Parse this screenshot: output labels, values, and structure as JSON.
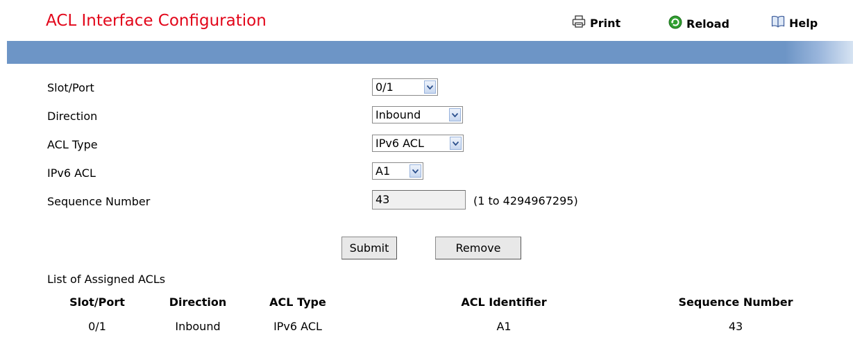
{
  "page": {
    "title": "ACL Interface Configuration"
  },
  "toolbar": {
    "print_label": "Print",
    "reload_label": "Reload",
    "help_label": "Help",
    "print_icon": "printer-icon",
    "reload_icon": "reload-icon",
    "help_icon": "help-book-icon"
  },
  "colors": {
    "title": "#e2061a",
    "bar": "#6d95c6",
    "reload_icon": "#2f9e2f"
  },
  "form": {
    "slot_port_label": "Slot/Port",
    "slot_port_value": "0/1",
    "direction_label": "Direction",
    "direction_value": "Inbound",
    "acl_type_label": "ACL Type",
    "acl_type_value": "IPv6 ACL",
    "ipv6_acl_label": "IPv6 ACL",
    "ipv6_acl_value": "A1",
    "sequence_label": "Sequence Number",
    "sequence_value": "43",
    "sequence_range": "(1 to 4294967295)"
  },
  "buttons": {
    "submit": "Submit",
    "remove": "Remove"
  },
  "table": {
    "title": "List of Assigned ACLs",
    "headers": [
      "Slot/Port",
      "Direction",
      "ACL Type",
      "ACL Identifier",
      "Sequence Number"
    ],
    "rows": [
      [
        "0/1",
        "Inbound",
        "IPv6 ACL",
        "A1",
        "43"
      ]
    ]
  }
}
